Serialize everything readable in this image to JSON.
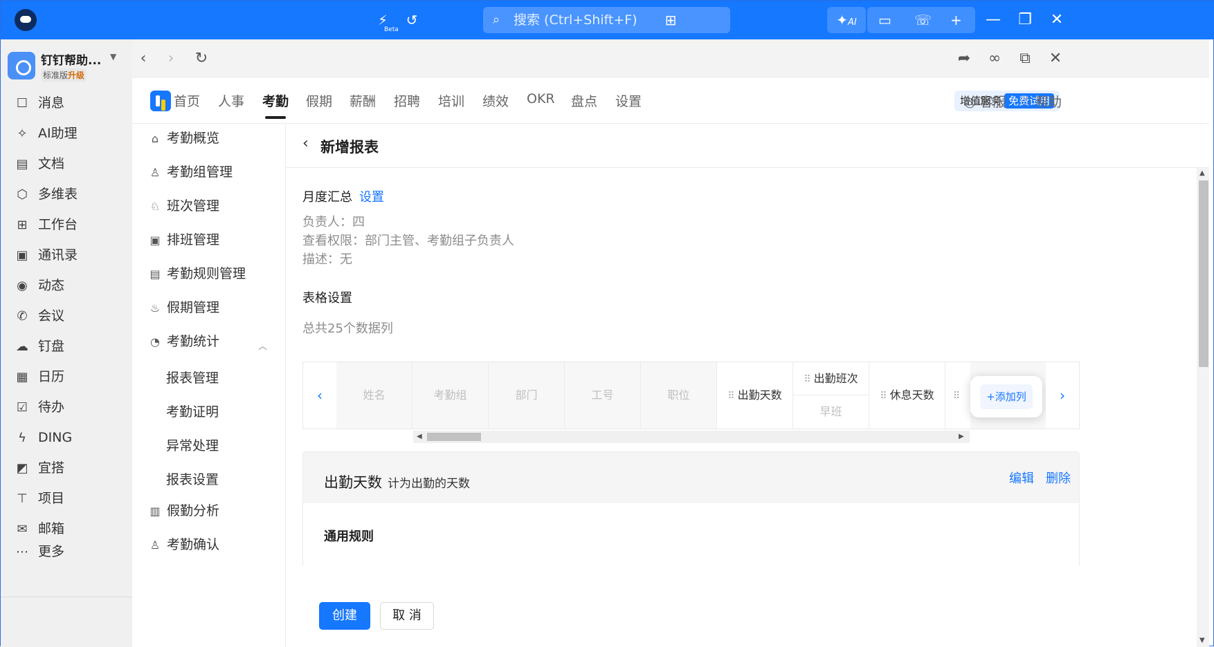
{
  "titlebar": {
    "search_placeholder": "搜索 (Ctrl+Shift+F)",
    "beta_label": "Beta",
    "ai_label": "AI",
    "icons": [
      "lightning-icon",
      "history-icon",
      "apps-grid-icon",
      "ai-magic-icon",
      "screen-cast-icon",
      "call-icon",
      "plus-icon",
      "minimize-icon",
      "restore-icon",
      "close-icon"
    ]
  },
  "org": {
    "name": "钉钉帮助...",
    "edition": "标准版",
    "upgrade": "升级"
  },
  "appnav": [
    {
      "label": "消息",
      "icon": "message-icon"
    },
    {
      "label": "AI助理",
      "icon": "ai-assistant-icon"
    },
    {
      "label": "文档",
      "icon": "document-icon"
    },
    {
      "label": "多维表",
      "icon": "table-icon"
    },
    {
      "label": "工作台",
      "icon": "workbench-icon"
    },
    {
      "label": "通讯录",
      "icon": "contacts-icon"
    },
    {
      "label": "动态",
      "icon": "feed-icon"
    },
    {
      "label": "会议",
      "icon": "meeting-icon"
    },
    {
      "label": "钉盘",
      "icon": "cloud-drive-icon"
    },
    {
      "label": "日历",
      "icon": "calendar-icon"
    },
    {
      "label": "待办",
      "icon": "todo-icon"
    },
    {
      "label": "DING",
      "icon": "ding-icon"
    },
    {
      "label": "宜搭",
      "icon": "yida-icon"
    },
    {
      "label": "项目",
      "icon": "project-icon"
    },
    {
      "label": "邮箱",
      "icon": "mail-icon"
    },
    {
      "label": "更多",
      "icon": "more-icon"
    }
  ],
  "topnav": {
    "tabs": [
      "首页",
      "人事",
      "考勤",
      "假期",
      "薪酬",
      "招聘",
      "培训",
      "绩效",
      "OKR",
      "盘点",
      "设置"
    ],
    "active_tab": "考勤",
    "value_service": "增值服务",
    "free_trial": "免费试用",
    "support": "客服",
    "help": "帮助"
  },
  "submenu": {
    "items": [
      {
        "label": "考勤概览",
        "icon": "home-icon"
      },
      {
        "label": "考勤组管理",
        "icon": "group-user-icon"
      },
      {
        "label": "班次管理",
        "icon": "shift-icon"
      },
      {
        "label": "排班管理",
        "icon": "schedule-icon"
      },
      {
        "label": "考勤规则管理",
        "icon": "rule-icon"
      },
      {
        "label": "假期管理",
        "icon": "holiday-icon"
      },
      {
        "label": "考勤统计",
        "icon": "stats-icon"
      }
    ],
    "stat_children": [
      "报表管理",
      "考勤证明",
      "异常处理",
      "报表设置"
    ],
    "more_items": [
      {
        "label": "假勤分析",
        "icon": "analysis-icon"
      },
      {
        "label": "考勤确认",
        "icon": "confirm-user-icon"
      }
    ]
  },
  "page": {
    "title": "新增报表",
    "report_name": "月度汇总",
    "settings_link": "设置",
    "owner": "负责人：四",
    "permission": "查看权限：部门主管、考勤组子负责人",
    "description": "描述：无",
    "table_settings": "表格设置",
    "total_columns": "总共25个数据列",
    "columns": {
      "name": "姓名",
      "group": "考勤组",
      "dept": "部门",
      "emp_id": "工号",
      "position": "职位",
      "attend_days": "出勤天数",
      "attend_shift": "出勤班次",
      "shift_early": "早班",
      "rest_days": "休息天数"
    },
    "add_column": "+添加列",
    "card": {
      "title": "出勤天数",
      "subtitle": "计为出勤的天数",
      "edit": "编辑",
      "delete": "删除",
      "rules": "通用规则"
    },
    "create_button": "创建",
    "cancel_button": "取 消"
  }
}
